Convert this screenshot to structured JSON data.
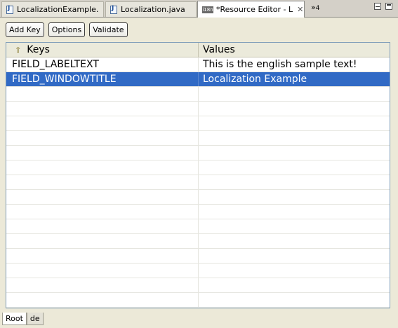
{
  "tabs": [
    {
      "label": "LocalizationExample.",
      "icon": "java-file-icon",
      "active": false
    },
    {
      "label": "Localization.java",
      "icon": "java-file-icon",
      "active": false
    },
    {
      "label": "*Resource Editor - L",
      "icon": "i18n-icon",
      "icon_text": "i18n",
      "active": true,
      "close": "✕"
    }
  ],
  "overflow": {
    "chevron": "»",
    "count": "4"
  },
  "toolbar": {
    "add_key": "Add Key",
    "options": "Options",
    "validate": "Validate"
  },
  "table": {
    "columns": {
      "keys": "Keys",
      "values": "Values"
    },
    "sort_indicator": "⇧",
    "rows": [
      {
        "key": "FIELD_LABELTEXT",
        "value": "This is the english sample text!",
        "selected": false
      },
      {
        "key": "FIELD_WINDOWTITLE",
        "value": "Localization Example",
        "selected": true
      }
    ]
  },
  "locale_tabs": [
    {
      "label": "Root",
      "active": true
    },
    {
      "label": "de",
      "active": false
    }
  ],
  "colors": {
    "selection": "#316ac5",
    "background": "#ece9d8"
  }
}
